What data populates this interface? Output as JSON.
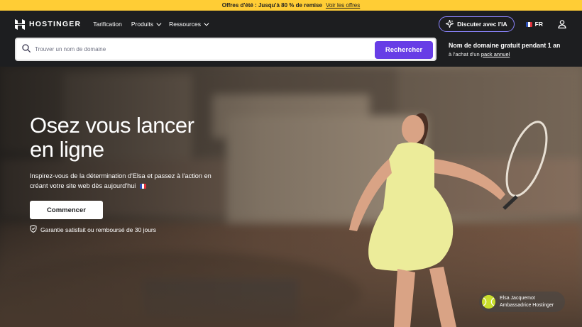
{
  "promo": {
    "text": "Offres d'été : Jusqu'à 80 % de remise",
    "link": "Voir les offres"
  },
  "nav": {
    "logo_text": "HOSTINGER",
    "links": [
      {
        "label": "Tarification",
        "has_dropdown": false
      },
      {
        "label": "Produits",
        "has_dropdown": true
      },
      {
        "label": "Ressources",
        "has_dropdown": true
      }
    ],
    "ai_button": "Discuter avec l'IA",
    "language": "FR",
    "icons": {
      "logo": "hostinger-logo-icon",
      "ai": "sparkle-icon",
      "user": "user-icon",
      "flag": "france-flag-icon"
    }
  },
  "search": {
    "placeholder": "Trouver un nom de domaine",
    "button": "Rechercher"
  },
  "domain_promo": {
    "title": "Nom de domaine gratuit pendant 1 an",
    "prefix": "à l'achat d'un",
    "link": "pack annuel"
  },
  "hero": {
    "title": "Osez vous lancer en ligne",
    "subtitle": "Inspirez-vous de la détermination d'Elsa et passez à l'action en créant votre site web dès aujourd'hui",
    "cta": "Commencer",
    "guarantee": "Garantie satisfait ou remboursé de 30 jours"
  },
  "ambassador": {
    "name": "Elsa Jacquemot",
    "role": "Ambassadrice Hostinger"
  },
  "colors": {
    "promo_bg": "#ffcd35",
    "nav_bg": "#1d1e20",
    "accent": "#673de6",
    "ai_border": "#8c85ff"
  }
}
